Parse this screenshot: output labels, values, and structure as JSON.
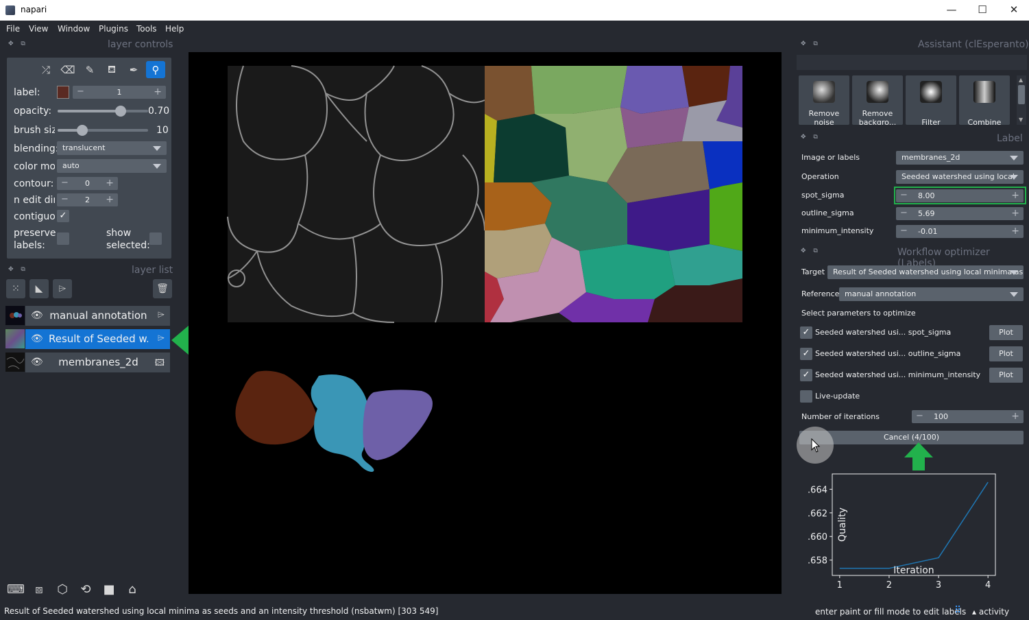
{
  "window": {
    "title": "napari",
    "minimize": "—",
    "maximize": "☐",
    "close": "✕"
  },
  "menu": [
    "File",
    "View",
    "Window",
    "Plugins",
    "Tools",
    "Help"
  ],
  "layer_controls": {
    "dock_title": "layer controls",
    "label_label": "label:",
    "label_value": "1",
    "label_color": "#5a2a22",
    "opacity_label": "opacity:",
    "opacity_value": "0.70",
    "opacity_fraction": 0.7,
    "brush_label": "brush siz",
    "brush_value": "10",
    "brush_fraction": 0.27,
    "blending_label": "blending:",
    "blending_value": "translucent",
    "colormode_label": "color moı",
    "colormode_value": "auto",
    "contour_label": "contour:",
    "contour_value": "0",
    "ndim_label": "n edit din",
    "ndim_value": "2",
    "contiguous_label": "contiguou",
    "preserve_label_1": "preserve",
    "preserve_label_2": "labels:",
    "show_selected_1": "show",
    "show_selected_2": "selected:"
  },
  "layer_list": {
    "dock_title": "layer list",
    "layers": [
      {
        "name": "manual annotation",
        "selected": false
      },
      {
        "name": "Result of Seeded w...",
        "selected": true
      },
      {
        "name": "membranes_2d",
        "selected": false
      }
    ]
  },
  "assistant": {
    "dock_title": "Assistant (clEsperanto)",
    "buttons": [
      {
        "line1": "Remove",
        "line2": "noise"
      },
      {
        "line1": "Remove",
        "line2": "backgro..."
      },
      {
        "line1": "",
        "line2": "Filter"
      },
      {
        "line1": "",
        "line2": "Combine"
      }
    ]
  },
  "label_panel": {
    "dock_title": "Label",
    "image_label": "Image or labels",
    "image_value": "membranes_2d",
    "operation_label": "Operation",
    "operation_value": "Seeded watershed using local",
    "spot_sigma_label": "spot_sigma",
    "spot_sigma_value": "8.00",
    "outline_sigma_label": "outline_sigma",
    "outline_sigma_value": "5.69",
    "min_intensity_label": "minimum_intensity",
    "min_intensity_value": "-0.01"
  },
  "optimizer": {
    "dock_title": "Workflow optimizer (Labels)",
    "target_label": "Target",
    "target_value": "Result of Seeded watershed using local minima as s",
    "reference_label": "Reference",
    "reference_value": "manual annotation",
    "select_params": "Select parameters to optimize",
    "params": [
      {
        "label": "Seeded watershed usi... spot_sigma",
        "checked": true,
        "plot": "Plot"
      },
      {
        "label": "Seeded watershed usi... outline_sigma",
        "checked": true,
        "plot": "Plot"
      },
      {
        "label": "Seeded watershed usi... minimum_intensity",
        "checked": true,
        "plot": "Plot"
      }
    ],
    "live_update_label": "Live-update",
    "iterations_label": "Number of iterations",
    "iterations_value": "100",
    "cancel_label": "Cancel (4/100)"
  },
  "chart_data": {
    "type": "line",
    "x": [
      1,
      2,
      3,
      4
    ],
    "values": [
      0.6573,
      0.6573,
      0.6582,
      0.6646
    ],
    "xlabel": "Iteration",
    "ylabel": "Quality",
    "xticks": [
      "1",
      "2",
      "3",
      "4"
    ],
    "yticks": [
      ".658",
      ".660",
      ".662",
      ".664"
    ],
    "ytick_values": [
      0.658,
      0.66,
      0.662,
      0.664
    ],
    "xlim": [
      0.85,
      4.15
    ],
    "ylim": [
      0.6567,
      0.6653
    ],
    "line_color": "#1f77b4"
  },
  "status": {
    "left": "Result of Seeded watershed using local minima as seeds and an intensity threshold (nsbatwm) [303 549]",
    "right": "enter paint or fill mode to edit labels",
    "activity": "activity"
  },
  "colors": {
    "accent": "#1474d4",
    "highlight": "#22b14c",
    "panel": "#414851",
    "background": "#262930"
  }
}
